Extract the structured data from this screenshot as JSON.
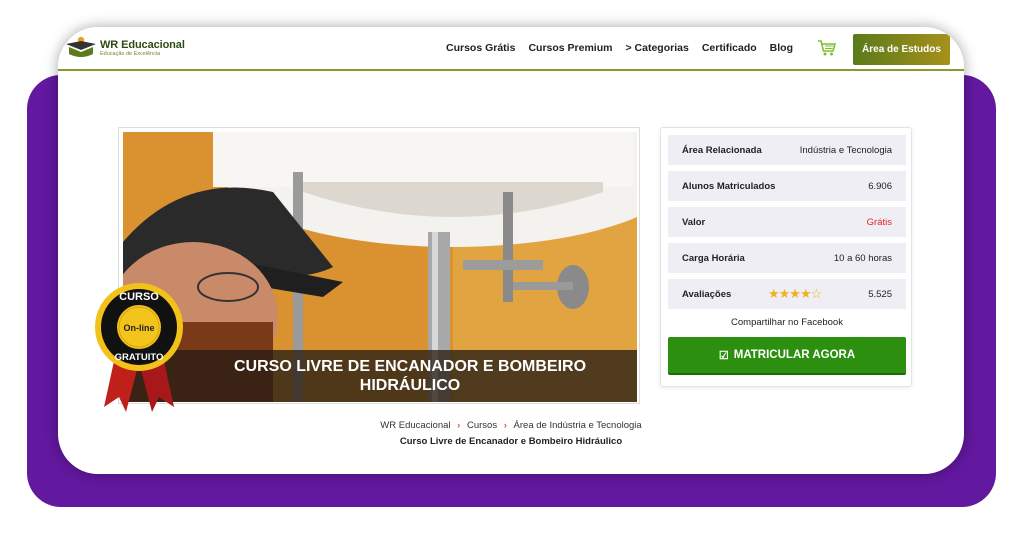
{
  "brand": {
    "title": "WR Educacional",
    "subtitle": "Educação de Excelência"
  },
  "nav": {
    "items": [
      "Cursos Grátis",
      "Cursos Premium",
      "> Categorias",
      "Certificado",
      "Blog"
    ],
    "cart_icon": "cart-icon",
    "cta": "Área de Estudos"
  },
  "hero": {
    "title_line1": "CURSO LIVRE DE ENCANADOR E BOMBEIRO",
    "title_line2": "HIDRÁULICO",
    "badge": {
      "top": "CURSO",
      "middle": "On-line",
      "bottom": "GRATUITO"
    }
  },
  "info": {
    "rows": [
      {
        "label": "Área Relacionada",
        "value": "Indústria e Tecnologia"
      },
      {
        "label": "Alunos Matriculados",
        "value": "6.906"
      },
      {
        "label": "Valor",
        "value": "Grátis"
      },
      {
        "label": "Carga Horária",
        "value": "10 a 60 horas"
      },
      {
        "label": "Avaliações",
        "value": "5.525"
      }
    ],
    "rating_stars": 4,
    "rating_max": 5,
    "share": "Compartilhar no Facebook",
    "enroll": "MATRICULAR AGORA",
    "accent_red": "#e0262a",
    "accent_green": "#2c8f10"
  },
  "breadcrumb": {
    "items": [
      "WR Educacional",
      "Cursos",
      "Área de Indústria e Tecnologia"
    ],
    "current": "Curso Livre de Encanador e Bombeiro Hidráulico"
  }
}
